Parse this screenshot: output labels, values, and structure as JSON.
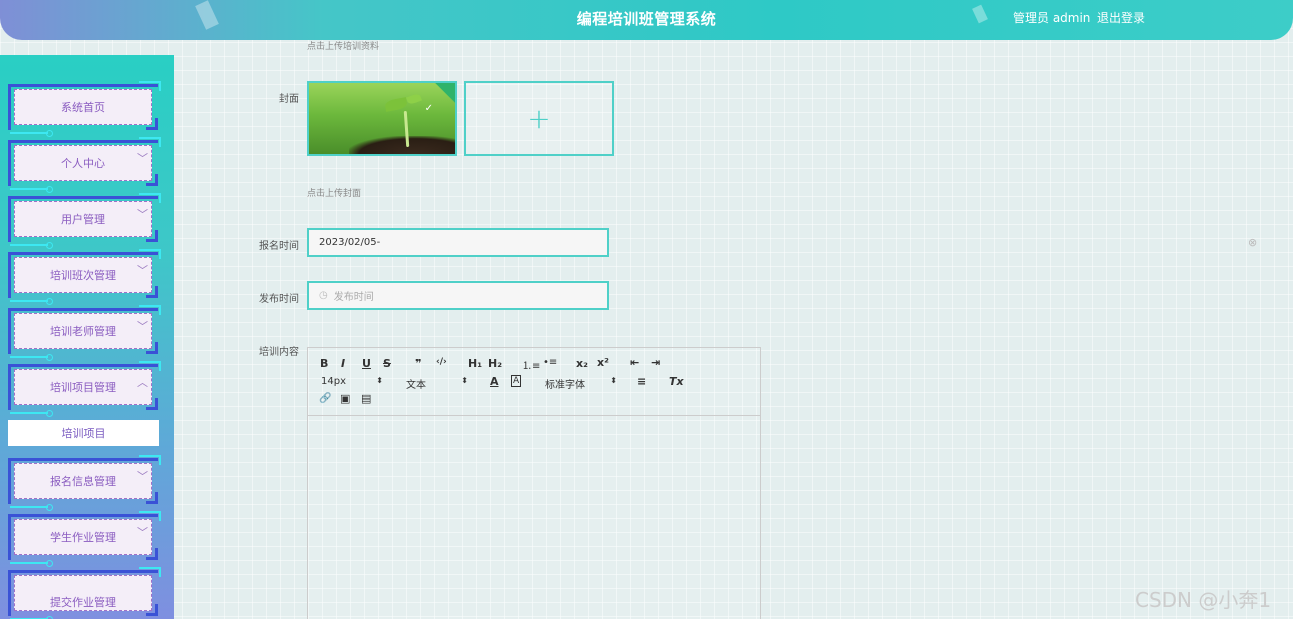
{
  "header": {
    "title": "编程培训班管理系统",
    "user": "管理员 admin",
    "logout": "退出登录"
  },
  "sidebar": {
    "items": [
      {
        "label": "系统首页",
        "has_chevron": false
      },
      {
        "label": "个人中心",
        "has_chevron": true,
        "chevron": "﹀"
      },
      {
        "label": "用户管理",
        "has_chevron": true,
        "chevron": "﹀"
      },
      {
        "label": "培训班次管理",
        "has_chevron": true,
        "chevron": "﹀"
      },
      {
        "label": "培训老师管理",
        "has_chevron": true,
        "chevron": "﹀"
      },
      {
        "label": "培训项目管理",
        "has_chevron": true,
        "chevron": "︿"
      },
      {
        "label": "报名信息管理",
        "has_chevron": true,
        "chevron": "﹀"
      },
      {
        "label": "学生作业管理",
        "has_chevron": true,
        "chevron": "﹀"
      },
      {
        "label": "提交作业管理",
        "has_chevron": false
      }
    ],
    "submenu": {
      "label": "培训项目"
    }
  },
  "form": {
    "upload_material_hint": "点击上传培训资料",
    "cover_label": "封面",
    "upload_cover_hint": "点击上传封面",
    "add_icon": "+",
    "signup_time_label": "报名时间",
    "signup_time_value": "2023/02/05-",
    "publish_time_label": "发布时间",
    "publish_time_placeholder": "发布时间",
    "content_label": "培训内容"
  },
  "editor": {
    "toolbar": {
      "bold": "B",
      "italic": "I",
      "underline": "U",
      "strike": "S",
      "quote": "❞",
      "code": "‹/›",
      "h1": "H₁",
      "h2": "H₂",
      "ordered_list": "⒈≡",
      "bullet_list": "•≡",
      "subscript": "x₂",
      "superscript": "x²",
      "indent_left": "⇤",
      "indent_right": "⇥",
      "size": "14px",
      "heading": "文本",
      "font_color": "A",
      "bg_color": "A",
      "font": "标准字体",
      "align": "≡",
      "clear_format": "Tx",
      "link": "🔗",
      "image": "▣",
      "video": "▤"
    }
  },
  "icons": {
    "clock": "clock-icon",
    "clear": "circle-close-icon",
    "check": "check-icon"
  },
  "watermark": "CSDN @小奔1",
  "colors": {
    "accent": "#4fd0c8",
    "menu_text": "#8a5cc0",
    "menu_border": "#3a52d6"
  }
}
